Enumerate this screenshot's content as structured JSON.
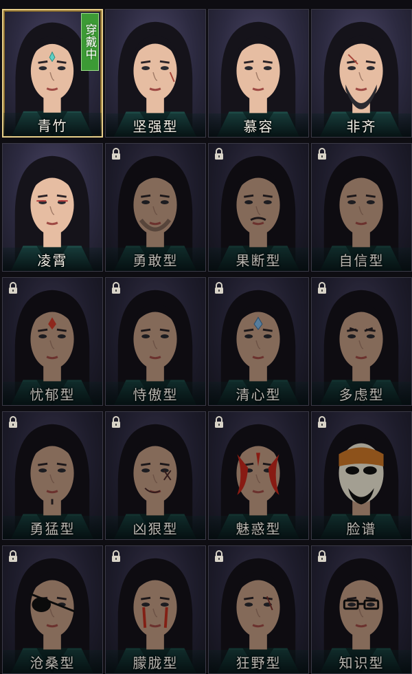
{
  "grid": {
    "columns": 4,
    "rows": 5,
    "equipped_badge_text": "穿戴中",
    "colors": {
      "selected_border": "#e8cf8a",
      "badge_green": "#3c9a35",
      "label_text": "#f3efe6",
      "tile_bg": "#2c2a40"
    }
  },
  "faces": [
    {
      "label": "青竹",
      "locked": false,
      "selected": true,
      "feature": "forehead-mark-teal"
    },
    {
      "label": "坚强型",
      "locked": false,
      "selected": false,
      "feature": "scar-cheek"
    },
    {
      "label": "慕容",
      "locked": false,
      "selected": false,
      "feature": "none"
    },
    {
      "label": "非齐",
      "locked": false,
      "selected": false,
      "feature": "beard-scar"
    },
    {
      "label": "凌霄",
      "locked": false,
      "selected": false,
      "feature": "red-eyeliner"
    },
    {
      "label": "勇敢型",
      "locked": true,
      "selected": false,
      "feature": "stubble"
    },
    {
      "label": "果断型",
      "locked": true,
      "selected": false,
      "feature": "mustache"
    },
    {
      "label": "自信型",
      "locked": true,
      "selected": false,
      "feature": "none"
    },
    {
      "label": "忧郁型",
      "locked": true,
      "selected": false,
      "feature": "forehead-mark-red"
    },
    {
      "label": "恃傲型",
      "locked": true,
      "selected": false,
      "feature": "none"
    },
    {
      "label": "清心型",
      "locked": true,
      "selected": false,
      "feature": "forehead-mark-blue"
    },
    {
      "label": "多虑型",
      "locked": true,
      "selected": false,
      "feature": "frown"
    },
    {
      "label": "勇猛型",
      "locked": true,
      "selected": false,
      "feature": "chin-mark"
    },
    {
      "label": "凶狠型",
      "locked": true,
      "selected": false,
      "feature": "cross-scars"
    },
    {
      "label": "魅惑型",
      "locked": true,
      "selected": false,
      "feature": "red-facepaint"
    },
    {
      "label": "脸谱",
      "locked": true,
      "selected": false,
      "feature": "opera-mask"
    },
    {
      "label": "沧桑型",
      "locked": true,
      "selected": false,
      "feature": "eyepatch"
    },
    {
      "label": "朦胧型",
      "locked": true,
      "selected": false,
      "feature": "red-tear-streaks"
    },
    {
      "label": "狂野型",
      "locked": true,
      "selected": false,
      "feature": "eye-scar"
    },
    {
      "label": "知识型",
      "locked": true,
      "selected": false,
      "feature": "glasses"
    }
  ]
}
